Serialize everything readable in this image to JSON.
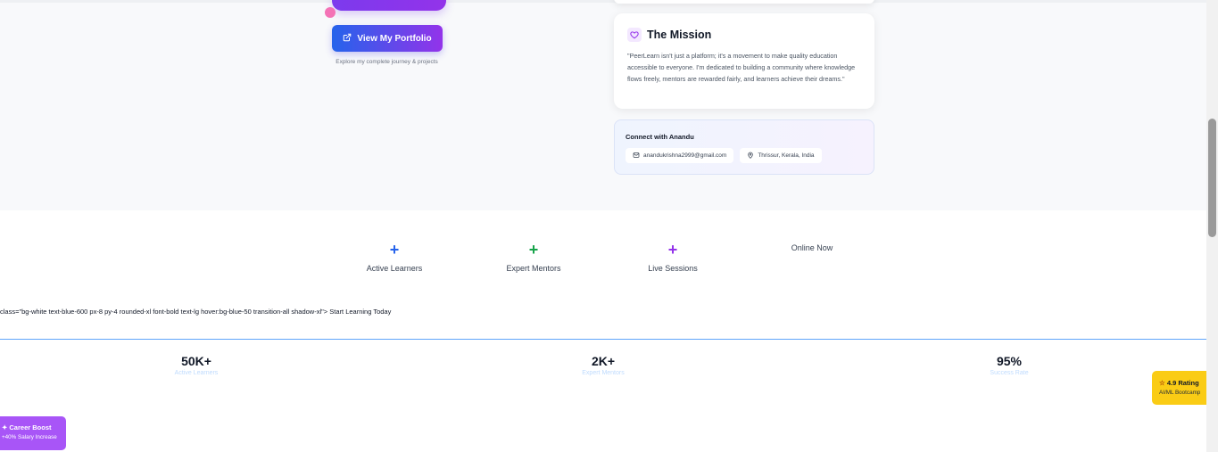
{
  "colors": {
    "accent_blue": "#2563eb",
    "accent_green": "#16a34a",
    "accent_purple": "#9333ea",
    "rating_yellow": "#facc15",
    "career_purple": "#a855f7"
  },
  "hero": {
    "portfolio_button": {
      "label": "View My Portfolio",
      "icon": "external-link-icon"
    },
    "portfolio_caption": "Explore my complete journey & projects"
  },
  "mission": {
    "icon": "heart-icon",
    "title": "The Mission",
    "text": "\"PeerLearn isn't just a platform; it's a movement to make quality education accessible to everyone. I'm dedicated to building a community where knowledge flows freely, mentors are rewarded fairly, and learners achieve their dreams.\""
  },
  "connect": {
    "title": "Connect with Anandu",
    "email": {
      "icon": "mail-icon",
      "text": "anandukrishna2999@gmail.com"
    },
    "location": {
      "icon": "map-pin-icon",
      "text": "Thrissur, Kerala, India"
    }
  },
  "features": [
    {
      "icon": "plus-icon",
      "label": "Active Learners",
      "color": "#2563eb"
    },
    {
      "icon": "plus-icon",
      "label": "Expert Mentors",
      "color": "#16a34a"
    },
    {
      "icon": "plus-icon",
      "label": "Live Sessions",
      "color": "#9333ea"
    }
  ],
  "online_now": "Online Now",
  "raw_text": "class=\"bg-white text-blue-600 px-8 py-4 rounded-xl font-bold text-lg hover:bg-blue-50 transition-all shadow-xl\"> Start Learning Today",
  "stats": [
    {
      "value": "50K+",
      "label": "Active Learners"
    },
    {
      "value": "2K+",
      "label": "Expert Mentors"
    },
    {
      "value": "95%",
      "label": "Success Rate"
    }
  ],
  "rating_badge": {
    "icon": "star-icon",
    "title": "4.9 Rating",
    "subtitle": "AI/ML Bootcamp"
  },
  "career_badge": {
    "icon": "sparkle-icon",
    "title": "Career Boost",
    "subtitle": "+40% Salary Increase"
  }
}
